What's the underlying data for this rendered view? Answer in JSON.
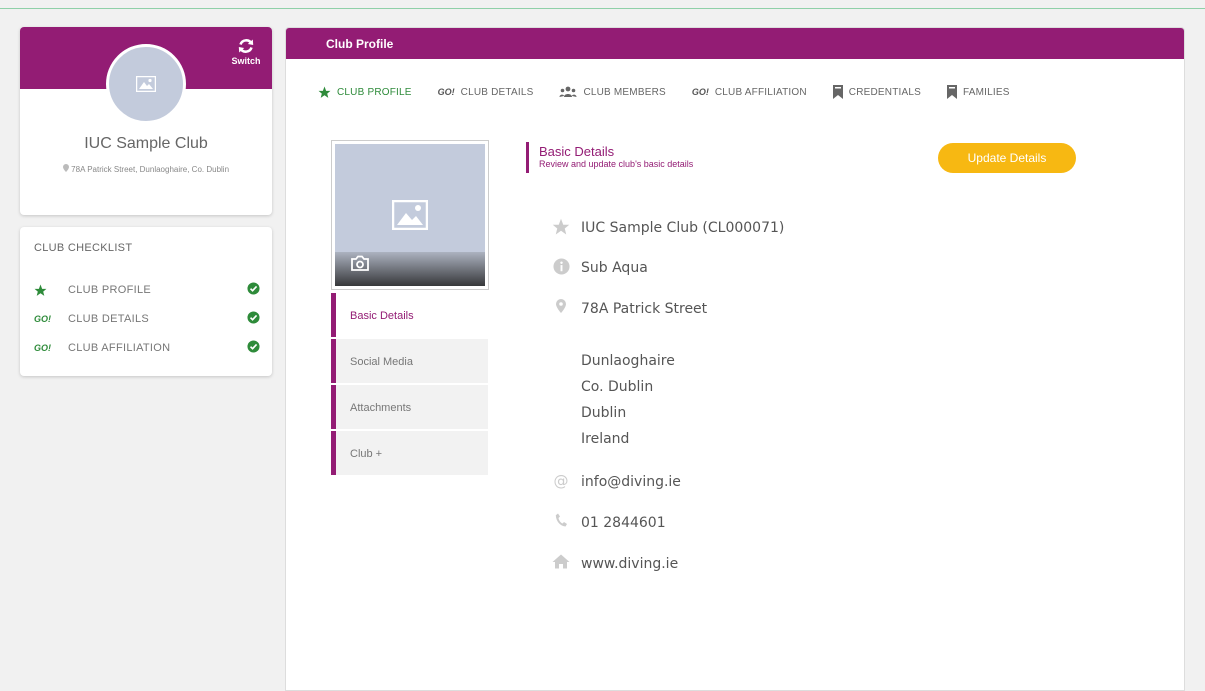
{
  "profile": {
    "switch_label": "Switch",
    "club_name": "IUC Sample Club",
    "address": "78A Patrick Street, Dunlaoghaire, Co. Dublin"
  },
  "checklist": {
    "title": "CLUB CHECKLIST",
    "items": [
      {
        "label": "CLUB PROFILE",
        "icon": "star-icon",
        "status": "complete"
      },
      {
        "label": "CLUB DETAILS",
        "icon": "go-icon",
        "status": "complete"
      },
      {
        "label": "CLUB AFFILIATION",
        "icon": "go-icon",
        "status": "complete"
      }
    ]
  },
  "main": {
    "header_title": "Club Profile",
    "tabs": [
      {
        "label": "CLUB PROFILE",
        "icon": "star-icon",
        "active": true
      },
      {
        "label": "CLUB DETAILS",
        "icon": "go-icon",
        "go_text": "GO!"
      },
      {
        "label": "CLUB MEMBERS",
        "icon": "members-icon"
      },
      {
        "label": "CLUB AFFILIATION",
        "icon": "go-icon",
        "go_text": "GO!"
      },
      {
        "label": "CREDENTIALS",
        "icon": "bookmark-icon"
      },
      {
        "label": "FAMILIES",
        "icon": "bookmark-icon"
      }
    ],
    "side_menu": [
      {
        "label": "Basic Details",
        "active": true
      },
      {
        "label": "Social Media"
      },
      {
        "label": "Attachments"
      },
      {
        "label": "Club +"
      }
    ],
    "section_title": "Basic Details",
    "section_subtitle": "Review and update club's basic details",
    "update_button": "Update Details",
    "details": {
      "club_name_code": "IUC Sample Club (CL000071)",
      "club_type": "Sub Aqua",
      "address_line1": "78A Patrick Street",
      "address_line2": "Dunlaoghaire",
      "address_line3": "Co. Dublin",
      "address_line4": "Dublin",
      "address_line5": "Ireland",
      "email": "info@diving.ie",
      "phone": "01 2844601",
      "website": "www.diving.ie"
    }
  },
  "colors": {
    "brand": "#931c74",
    "accent_green": "#2e8b3a",
    "button_yellow": "#f7b812"
  },
  "checklist_go_text": "GO!"
}
